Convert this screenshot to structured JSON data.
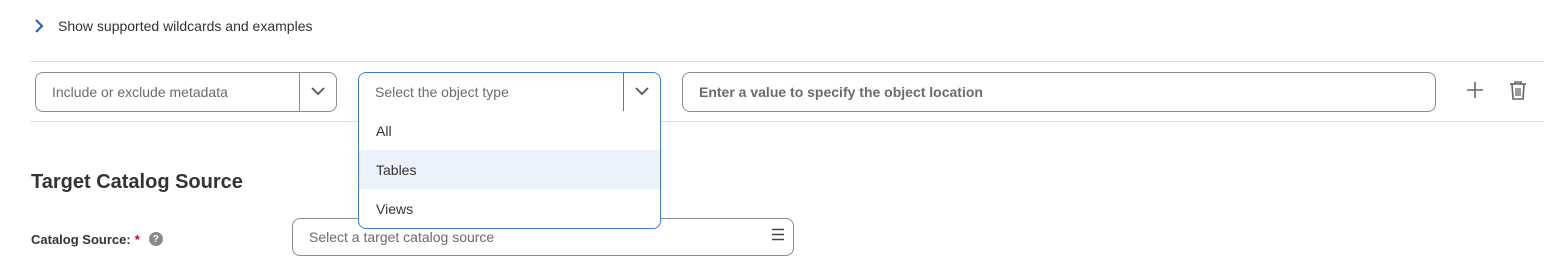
{
  "wildcards": {
    "toggle_label": "Show supported wildcards and examples",
    "icon": "chevron-right-icon"
  },
  "filter_row": {
    "metadata_select": {
      "placeholder": "Include or exclude metadata",
      "icon": "chevron-down-icon"
    },
    "object_type_select": {
      "placeholder": "Select the object type",
      "icon": "chevron-down-icon",
      "options": [
        "All",
        "Tables",
        "Views"
      ],
      "highlighted_option": "Tables"
    },
    "location_input": {
      "placeholder": "Enter a value to specify the object location",
      "value": ""
    },
    "add_icon": "plus-icon",
    "delete_icon": "trash-icon"
  },
  "target_section": {
    "title": "Target Catalog Source",
    "catalog_source": {
      "label": "Catalog Source:",
      "required_marker": "*",
      "help_icon": "question-mark-icon",
      "help_glyph": "?",
      "placeholder": "Select a target catalog source",
      "icon": "list-icon"
    }
  },
  "colors": {
    "accent": "#3b7fd6",
    "highlight": "#ebf2fc",
    "required": "#d0021b",
    "chevron": "#1f5fb8"
  }
}
